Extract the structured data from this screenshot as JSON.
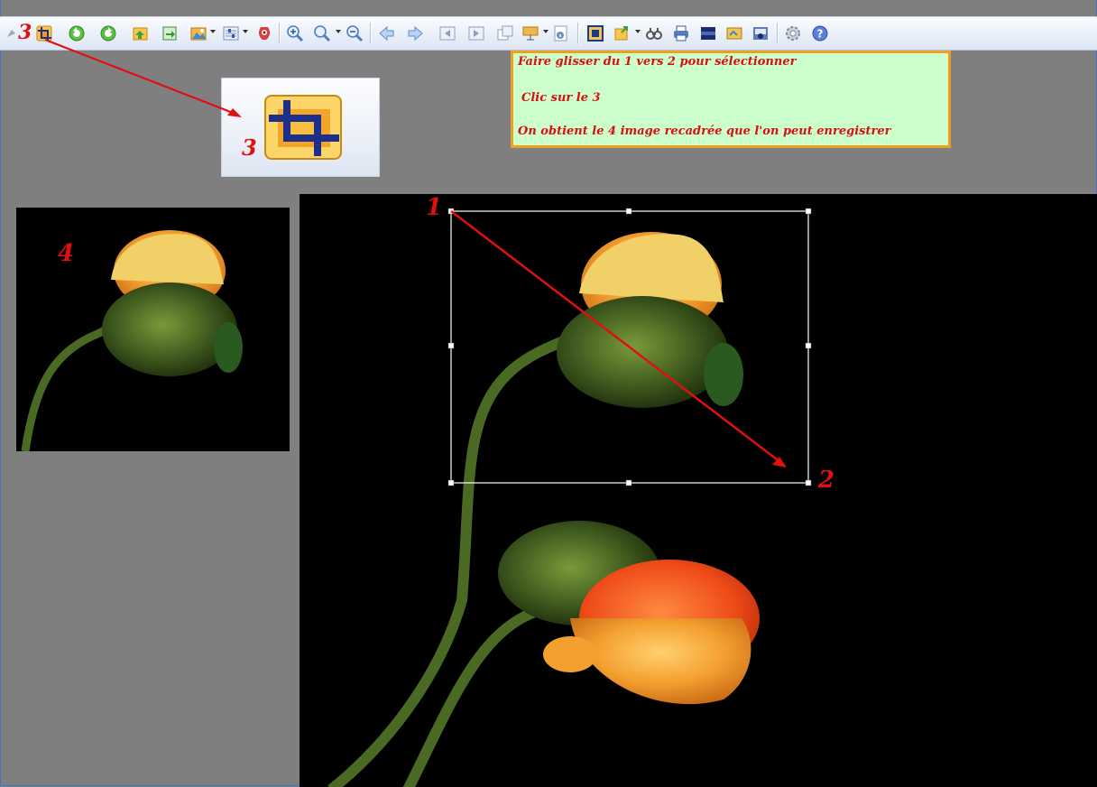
{
  "toolbar": {
    "buttons": [
      {
        "name": "crop-icon",
        "color": "#f0a818"
      },
      {
        "name": "rotate-left-icon",
        "color": "#4caf30"
      },
      {
        "name": "rotate-right-icon",
        "color": "#4caf30"
      },
      {
        "name": "open-icon",
        "color": "#f0a818"
      },
      {
        "name": "export-icon",
        "color": "#3aa040"
      },
      {
        "name": "image-effects-icon",
        "color": "#3a8cd8"
      },
      {
        "name": "adjust-icon",
        "color": "#6f8fbf"
      },
      {
        "name": "red-eye-icon",
        "color": "#d03030"
      },
      {
        "name": "zoom-in-icon",
        "color": "#4a7fc0"
      },
      {
        "name": "zoom-icon",
        "color": "#4a7fc0"
      },
      {
        "name": "zoom-out-icon",
        "color": "#4a7fc0"
      },
      {
        "name": "back-icon",
        "color": "#5a8ed0"
      },
      {
        "name": "forward-icon",
        "color": "#5a8ed0"
      },
      {
        "name": "first-icon",
        "color": "#8aa0c0"
      },
      {
        "name": "last-icon",
        "color": "#8aa0c0"
      },
      {
        "name": "copy-icon",
        "color": "#8aa0c0"
      },
      {
        "name": "slideshow-icon",
        "color": "#f0a818"
      },
      {
        "name": "info-icon",
        "color": "#6f8fbf"
      },
      {
        "name": "fullscreen-icon",
        "color": "#1a3a8a"
      },
      {
        "name": "share-icon",
        "color": "#f0a818"
      },
      {
        "name": "find-icon",
        "color": "#555555"
      },
      {
        "name": "print-icon",
        "color": "#3a5c9a"
      },
      {
        "name": "film-strip-icon",
        "color": "#1a2a6a"
      },
      {
        "name": "send-icon",
        "color": "#3a8ad8"
      },
      {
        "name": "capture-icon",
        "color": "#3a5c9a"
      },
      {
        "name": "settings-icon",
        "color": "#7a8aa0"
      },
      {
        "name": "help-icon",
        "color": "#5a80d8"
      }
    ]
  },
  "annotations": {
    "crop_number": "3",
    "zoom_number": "3",
    "thumb_number": "4",
    "sel_start_number": "1",
    "sel_end_number": "2",
    "accent_color": "#e01010"
  },
  "instructions": {
    "line1": "Faire glisser du 1 vers 2 pour sélectionner",
    "line2": "Clic sur le 3",
    "line3": "On obtient le 4 image recadrée que l'on peut enregistrer"
  }
}
